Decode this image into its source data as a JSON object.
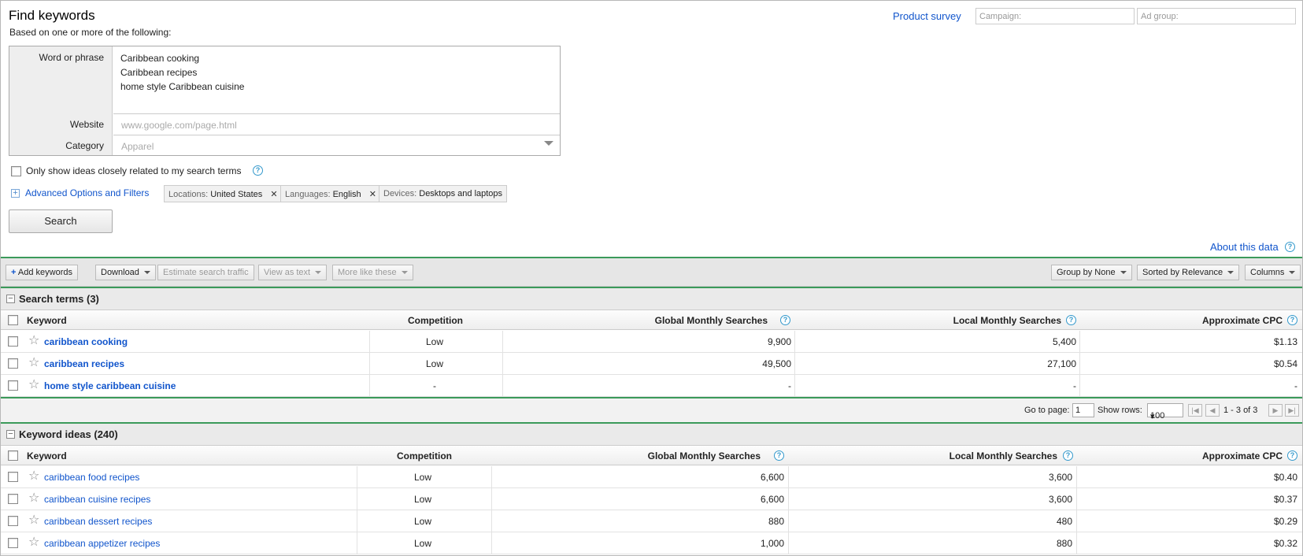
{
  "header": {
    "title": "Find keywords",
    "subtitle": "Based on one or more of the following:",
    "survey_link": "Product survey",
    "campaign_placeholder": "Campaign:",
    "adgroup_placeholder": "Ad group:"
  },
  "form": {
    "word_label": "Word or phrase",
    "phrases": [
      "Caribbean cooking",
      "Caribbean recipes",
      "home style Caribbean cuisine"
    ],
    "website_label": "Website",
    "website_placeholder": "www.google.com/page.html",
    "category_label": "Category",
    "category_placeholder": "Apparel",
    "only_show_label": "Only show ideas closely related to my search terms",
    "advanced_link": "Advanced Options and Filters",
    "filters": [
      {
        "key": "Locations:",
        "value": "United States",
        "removable": true
      },
      {
        "key": "Languages:",
        "value": "English",
        "removable": true
      },
      {
        "key": "Devices:",
        "value": "Desktops and laptops",
        "removable": false
      }
    ],
    "search_button": "Search"
  },
  "about_link": "About this data",
  "toolbar": {
    "add_keywords": "Add keywords",
    "download": "Download",
    "estimate": "Estimate search traffic",
    "view_as_text": "View as text",
    "more_like_these": "More like these",
    "group_by": "Group by None",
    "sorted_by": "Sorted by Relevance",
    "columns": "Columns"
  },
  "columns": {
    "keyword": "Keyword",
    "competition": "Competition",
    "global": "Global Monthly Searches",
    "local": "Local Monthly Searches",
    "cpc": "Approximate CPC"
  },
  "search_terms": {
    "title": "Search terms (3)",
    "rows": [
      {
        "keyword": "caribbean cooking",
        "competition": "Low",
        "global": "9,900",
        "local": "5,400",
        "cpc": "$1.13"
      },
      {
        "keyword": "caribbean recipes",
        "competition": "Low",
        "global": "49,500",
        "local": "27,100",
        "cpc": "$0.54"
      },
      {
        "keyword": "home style caribbean cuisine",
        "competition": "-",
        "global": "-",
        "local": "-",
        "cpc": "-"
      }
    ]
  },
  "pager": {
    "go_to_page_label": "Go to page:",
    "page_value": "1",
    "show_rows_label": "Show rows:",
    "rows_value": "100",
    "range_text": "1 - 3 of 3"
  },
  "keyword_ideas": {
    "title": "Keyword ideas (240)",
    "rows": [
      {
        "keyword": "caribbean food recipes",
        "competition": "Low",
        "global": "6,600",
        "local": "3,600",
        "cpc": "$0.40"
      },
      {
        "keyword": "caribbean cuisine recipes",
        "competition": "Low",
        "global": "6,600",
        "local": "3,600",
        "cpc": "$0.37"
      },
      {
        "keyword": "caribbean dessert recipes",
        "competition": "Low",
        "global": "880",
        "local": "480",
        "cpc": "$0.29"
      },
      {
        "keyword": "caribbean appetizer recipes",
        "competition": "Low",
        "global": "1,000",
        "local": "880",
        "cpc": "$0.32"
      }
    ]
  }
}
